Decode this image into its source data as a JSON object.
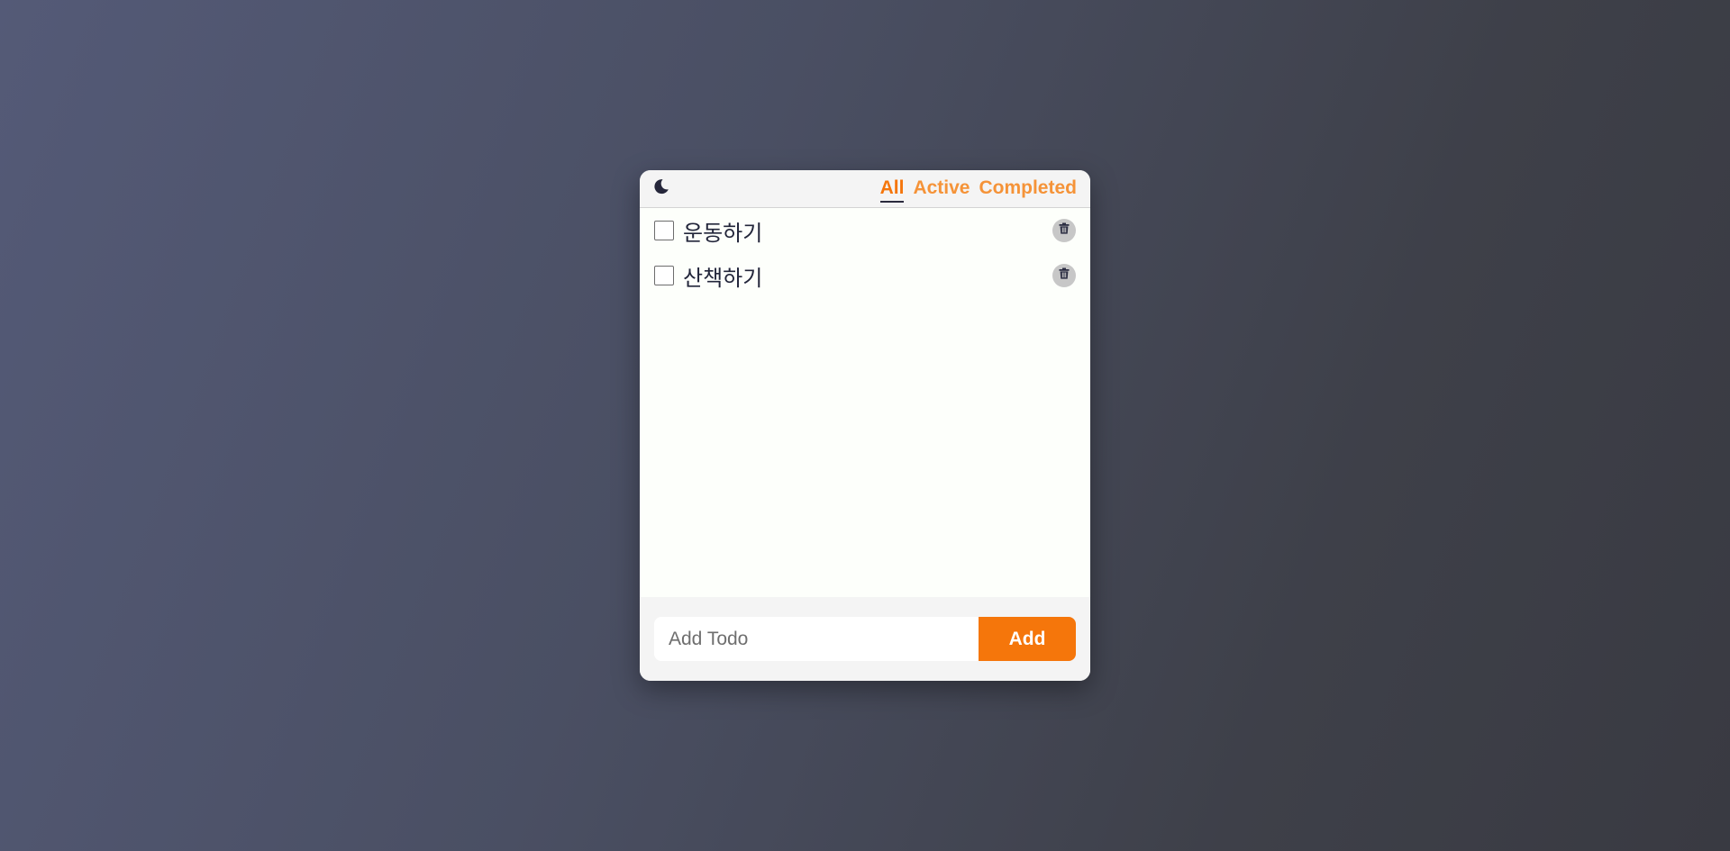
{
  "header": {
    "mode_icon": "moon-icon",
    "filters": [
      {
        "label": "All",
        "selected": true
      },
      {
        "label": "Active",
        "selected": false
      },
      {
        "label": "Completed",
        "selected": false
      }
    ]
  },
  "todos": [
    {
      "text": "운동하기",
      "completed": false,
      "delete_icon": "trash-icon"
    },
    {
      "text": "산책하기",
      "completed": false,
      "delete_icon": "trash-icon"
    }
  ],
  "add_form": {
    "placeholder": "Add Todo",
    "value": "",
    "button_label": "Add"
  },
  "colors": {
    "accent": "#f5760b",
    "filter_inactive": "#f59338",
    "text": "#22253a"
  }
}
